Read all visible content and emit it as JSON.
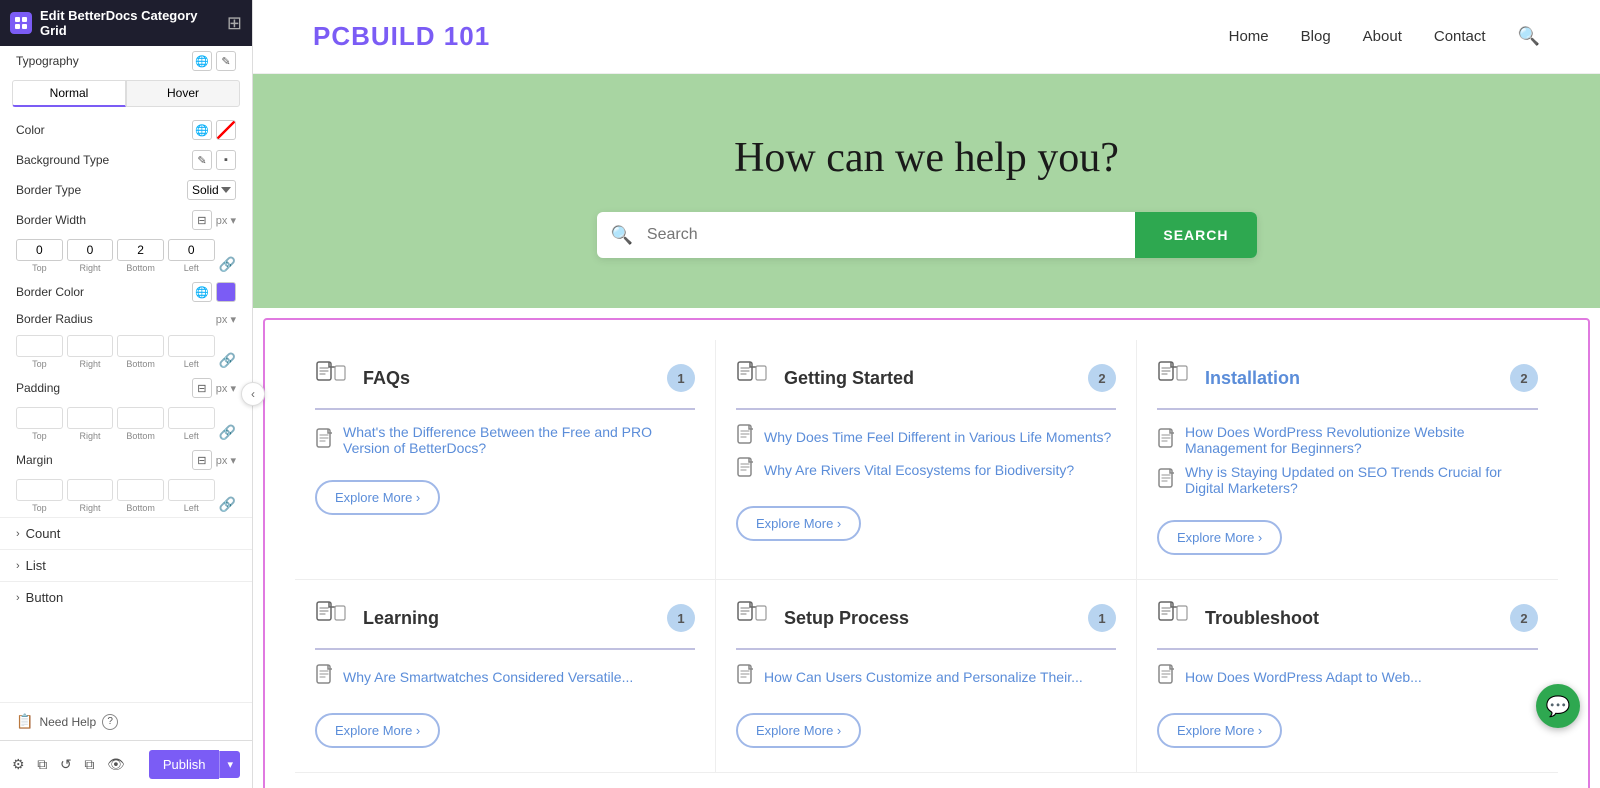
{
  "panel": {
    "title": "Edit BetterDocs Category Grid",
    "typography_label": "Typography",
    "normal_label": "Normal",
    "hover_label": "Hover",
    "color_label": "Color",
    "bg_type_label": "Background Type",
    "border_type_label": "Border Type",
    "border_type_value": "Solid",
    "border_width_label": "Border Width",
    "border_width_unit": "px",
    "border_top": "0",
    "border_right": "0",
    "border_bottom": "2",
    "border_left": "0",
    "border_color_label": "Border Color",
    "border_radius_label": "Border Radius",
    "border_radius_unit": "px",
    "padding_label": "Padding",
    "padding_unit": "px",
    "margin_label": "Margin",
    "margin_unit": "px",
    "count_label": "Count",
    "list_label": "List",
    "button_label": "Button",
    "need_help_text": "Need Help",
    "publish_label": "Publish",
    "sub_labels": [
      "Top",
      "Right",
      "Bottom",
      "Left"
    ]
  },
  "site": {
    "logo": "PCBUILD 101",
    "nav": [
      "Home",
      "Blog",
      "About",
      "Contact"
    ],
    "hero_title": "How can we help you?",
    "search_placeholder": "Search",
    "search_btn_label": "SEARCH",
    "categories": [
      {
        "title": "FAQs",
        "count": "1",
        "links": [
          "What's the Difference Between the Free and PRO Version of BetterDocs?"
        ],
        "explore_label": "Explore More"
      },
      {
        "title": "Getting Started",
        "count": "2",
        "links": [
          "Why Does Time Feel Different in Various Life Moments?",
          "Why Are Rivers Vital Ecosystems for Biodiversity?"
        ],
        "explore_label": "Explore More"
      },
      {
        "title": "Installation",
        "count": "2",
        "links": [
          "How Does WordPress Revolutionize Website Management for Beginners?",
          "Why is Staying Updated on SEO Trends Crucial for Digital Marketers?"
        ],
        "explore_label": "Explore More"
      },
      {
        "title": "Learning",
        "count": "1",
        "links": [
          "Why Are Smartwatches Considered Versatile..."
        ],
        "explore_label": "Explore More"
      },
      {
        "title": "Setup Process",
        "count": "1",
        "links": [
          "How Can Users Customize and Personalize Their..."
        ],
        "explore_label": "Explore More"
      },
      {
        "title": "Troubleshoot",
        "count": "2",
        "links": [
          "How Does WordPress Adapt to Web..."
        ],
        "explore_label": "Explore More"
      }
    ]
  },
  "icons": {
    "grid": "⊞",
    "globe": "🌐",
    "pencil": "✎",
    "link": "🔗",
    "doc": "📄",
    "search": "🔍",
    "chat": "💬",
    "arrow_right": "›",
    "arrow_down": "▾",
    "chevron_left": "‹",
    "settings": "⚙",
    "layers": "⧉",
    "history": "↺",
    "copy": "⧉",
    "eye": "👁"
  }
}
